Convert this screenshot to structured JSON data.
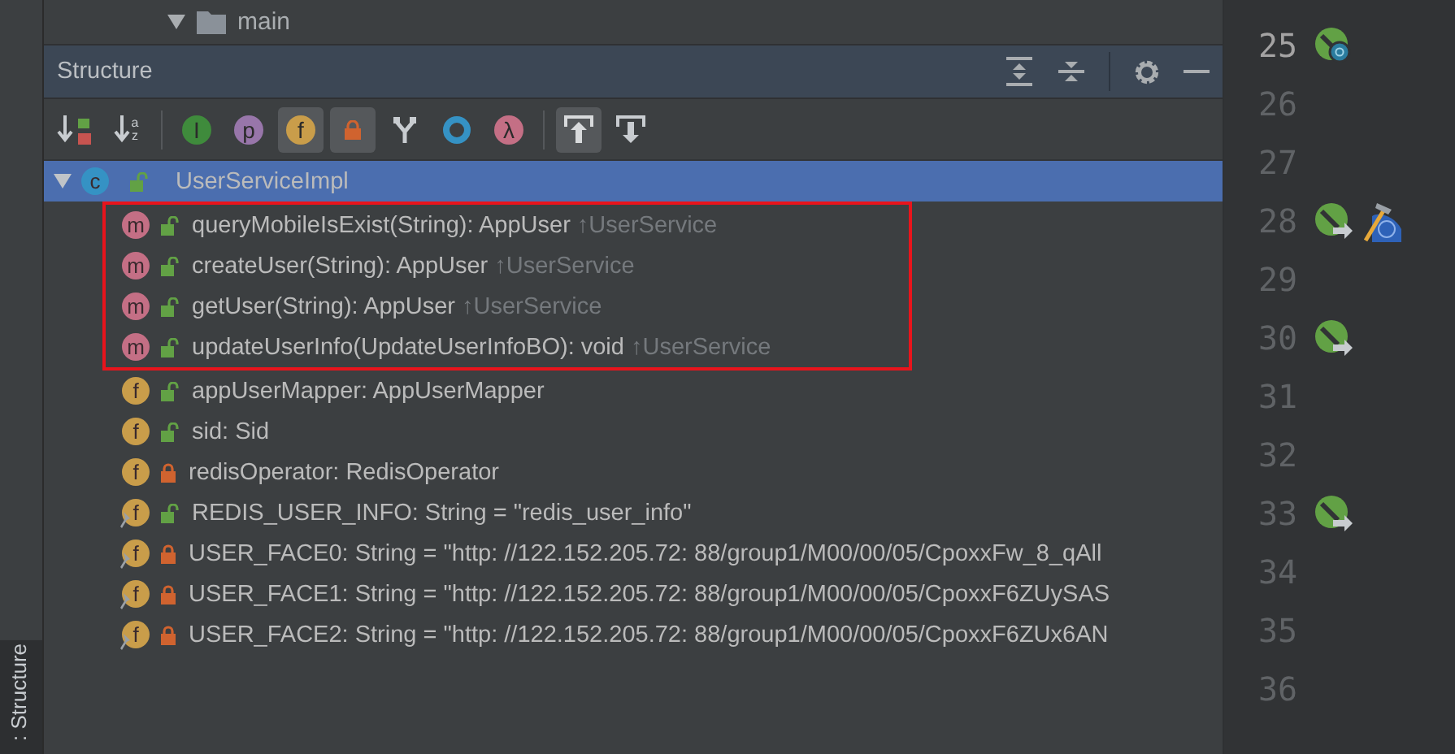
{
  "project_row": {
    "expanded": true,
    "label": "main"
  },
  "panel": {
    "title": "Structure"
  },
  "toolbar": [
    {
      "kind": "sort-visibility",
      "selected": false
    },
    {
      "kind": "sort-alpha",
      "glyph": "az",
      "selected": false
    },
    {
      "kind": "separator"
    },
    {
      "kind": "inherited",
      "glyph": "I",
      "selected": false
    },
    {
      "kind": "properties",
      "glyph": "p",
      "selected": false
    },
    {
      "kind": "fields",
      "glyph": "f",
      "selected": true
    },
    {
      "kind": "non-public",
      "selected": true
    },
    {
      "kind": "hierarchy",
      "selected": false
    },
    {
      "kind": "anonymous",
      "selected": false
    },
    {
      "kind": "lambda",
      "glyph": "λ",
      "selected": false
    },
    {
      "kind": "separator"
    },
    {
      "kind": "autoscroll-to-source",
      "selected": true
    },
    {
      "kind": "autoscroll-from-source",
      "selected": false
    }
  ],
  "tree": [
    {
      "kind": "class",
      "glyph": "c",
      "private": false,
      "label": "UserServiceImpl",
      "expanded": true,
      "selected": true,
      "children": [
        {
          "kind": "method",
          "glyph": "m",
          "private": false,
          "static_final": false,
          "highlighted": true,
          "label": "queryMobileIsExist(String): AppUser",
          "inherited_from": "↑UserService"
        },
        {
          "kind": "method",
          "glyph": "m",
          "private": false,
          "static_final": false,
          "highlighted": true,
          "label": "createUser(String): AppUser",
          "inherited_from": "↑UserService"
        },
        {
          "kind": "method",
          "glyph": "m",
          "private": false,
          "static_final": false,
          "highlighted": true,
          "label": "getUser(String): AppUser",
          "inherited_from": "↑UserService"
        },
        {
          "kind": "method",
          "glyph": "m",
          "private": false,
          "static_final": false,
          "highlighted": true,
          "label": "updateUserInfo(UpdateUserInfoBO): void",
          "inherited_from": "↑UserService"
        },
        {
          "kind": "field",
          "glyph": "f",
          "private": false,
          "static_final": false,
          "highlighted": false,
          "label": "appUserMapper: AppUserMapper"
        },
        {
          "kind": "field",
          "glyph": "f",
          "private": false,
          "static_final": false,
          "highlighted": false,
          "label": "sid: Sid"
        },
        {
          "kind": "field",
          "glyph": "f",
          "private": true,
          "static_final": false,
          "highlighted": false,
          "label": "redisOperator: RedisOperator"
        },
        {
          "kind": "field",
          "glyph": "f",
          "private": false,
          "static_final": true,
          "highlighted": false,
          "label": "REDIS_USER_INFO: String = \"redis_user_info\""
        },
        {
          "kind": "field",
          "glyph": "f",
          "private": true,
          "static_final": true,
          "highlighted": false,
          "label": "USER_FACE0: String = \"http: //122.152.205.72: 88/group1/M00/00/05/CpoxxFw_8_qAll"
        },
        {
          "kind": "field",
          "glyph": "f",
          "private": true,
          "static_final": true,
          "highlighted": false,
          "label": "USER_FACE1: String = \"http: //122.152.205.72: 88/group1/M00/00/05/CpoxxF6ZUySAS"
        },
        {
          "kind": "field",
          "glyph": "f",
          "private": true,
          "static_final": true,
          "highlighted": false,
          "label": "USER_FACE2: String = \"http: //122.152.205.72: 88/group1/M00/00/05/CpoxxF6ZUx6AN"
        }
      ]
    }
  ],
  "side_tab": {
    "label": ": Structure",
    "selected": true
  },
  "gutter": [
    {
      "number": "25",
      "current": true,
      "markers": [
        {
          "kind": "implements"
        }
      ]
    },
    {
      "number": "26",
      "current": false
    },
    {
      "number": "27",
      "current": false
    },
    {
      "number": "28",
      "current": false,
      "markers": [
        {
          "kind": "overrides"
        },
        {
          "kind": "build"
        }
      ]
    },
    {
      "number": "29",
      "current": false
    },
    {
      "number": "30",
      "current": false,
      "markers": [
        {
          "kind": "overrides"
        }
      ]
    },
    {
      "number": "31",
      "current": false
    },
    {
      "number": "32",
      "current": false
    },
    {
      "number": "33",
      "current": false,
      "markers": [
        {
          "kind": "overrides"
        }
      ]
    },
    {
      "number": "34",
      "current": false
    },
    {
      "number": "35",
      "current": false
    },
    {
      "number": "36",
      "current": false
    }
  ]
}
